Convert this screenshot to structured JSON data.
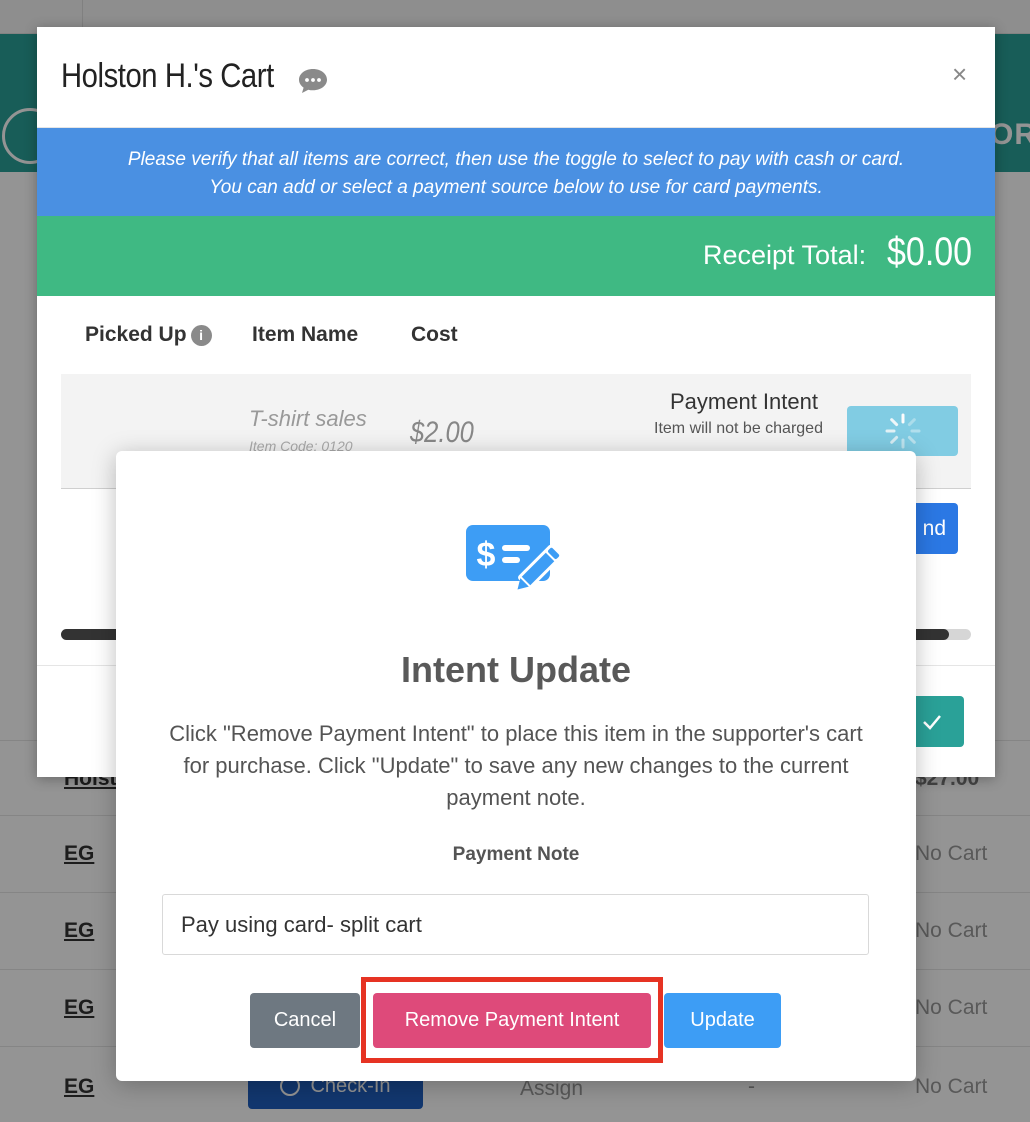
{
  "background": {
    "brand_text_partial": "ORE",
    "rows": [
      {
        "name": "Holsto",
        "amount": "$27.00"
      },
      {
        "name": "EG",
        "cart": "No Cart"
      },
      {
        "name": "EG",
        "cart": "No Cart"
      },
      {
        "name": "EG",
        "cart": "No Cart"
      },
      {
        "name": "EG",
        "checkin_label": "Check-In",
        "assign": "Assign",
        "dash": "-",
        "cart": "No Cart"
      }
    ]
  },
  "cart_modal": {
    "title": "Holston H.'s Cart",
    "close": "×",
    "info_line1": "Please verify that all items are correct, then use the toggle to select to pay with cash or card.",
    "info_line2": "You can add or select a payment source below to use for card payments.",
    "receipt_total_label": "Receipt Total:",
    "receipt_total_value": "$0.00",
    "columns": {
      "picked_up": "Picked Up",
      "item_name": "Item Name",
      "cost": "Cost"
    },
    "item": {
      "name": "T-shirt sales",
      "code": "Item Code: 0120",
      "cost": "$2.00",
      "payment_intent_label": "Payment Intent",
      "payment_intent_sub": "Item will not be charged"
    },
    "partial_button_text": "nd"
  },
  "intent_dialog": {
    "title": "Intent Update",
    "body": "Click \"Remove Payment Intent\" to place this item in the supporter's cart for purchase. Click \"Update\" to save any new changes to the current payment note.",
    "note_label": "Payment Note",
    "note_value": "Pay using card- split cart",
    "buttons": {
      "cancel": "Cancel",
      "remove": "Remove Payment Intent",
      "update": "Update"
    }
  },
  "colors": {
    "accent_blue": "#4a90e2",
    "total_green": "#3fb983",
    "remove_pink": "#de4a7a",
    "update_blue": "#3d9df5",
    "highlight_red": "#e63323"
  }
}
